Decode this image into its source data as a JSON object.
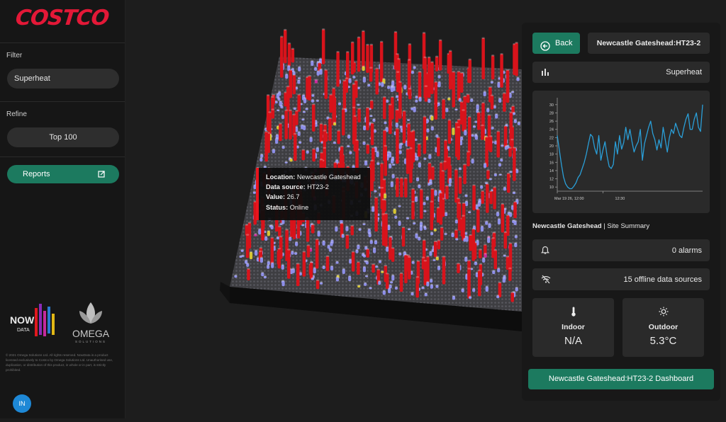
{
  "brand": {
    "logo_text": "COSTCO",
    "logo_color": "#e31837"
  },
  "sidebar": {
    "filter_label": "Filter",
    "filter_value": "Superheat",
    "refine_label": "Refine",
    "refine_value": "Top 100",
    "reports_label": "Reports",
    "reports_icon": "external-link-icon",
    "partner_logo_1": "NOW DATA",
    "partner_logo_2": "OMEGA",
    "partner_logo_2_tagline": "SOLUTIONS",
    "fine_print": "© 2021 Omega Solutions Ltd. All rights reserved. NowData is a product licensed exclusively to Costco by Omega Solutions Ltd. Unauthorised use, duplication, or distribution of this product, in whole or in part, is strictly prohibited.",
    "avatar_initials": "IN"
  },
  "tooltip": {
    "location_key": "Location:",
    "location_val": "Newcastle Gateshead",
    "source_key": "Data source:",
    "source_val": "HT23-2",
    "value_key": "Value:",
    "value_val": "26.7",
    "status_key": "Status:",
    "status_val": "Online"
  },
  "panel": {
    "back_label": "Back",
    "site_title": "Newcastle Gateshead:HT23-2",
    "metric_label": "Superheat",
    "metric_icon": "bar-chart-icon",
    "summary_site": "Newcastle Gateshead",
    "summary_suffix": " | Site Summary",
    "alarms_label": "0 alarms",
    "offline_label": "15 offline data sources",
    "indoor_label": "Indoor",
    "indoor_value": "N/A",
    "outdoor_label": "Outdoor",
    "outdoor_value": "5.3°C",
    "dashboard_label": "Newcastle Gateshead:HT23-2 Dashboard"
  },
  "colors": {
    "accent": "#1c7a5f",
    "bar_red": "#d8131b",
    "bar_blue": "#8d8ee8",
    "bar_yellow": "#d6c532",
    "bar_magenta": "#cc2a9c",
    "line": "#2a9fd8"
  },
  "chart_data": {
    "type": "line",
    "yticks": [
      10,
      12,
      14,
      16,
      18,
      20,
      22,
      24,
      26,
      28,
      30
    ],
    "ylim": [
      9,
      31
    ],
    "xtick_labels": [
      "Mar 19 26, 12:00",
      "12:30"
    ],
    "x": [
      0,
      1,
      2,
      3,
      4,
      5,
      6,
      7,
      8,
      9,
      10,
      11,
      12,
      13,
      14,
      15,
      16,
      17,
      18,
      19,
      20,
      21,
      22,
      23,
      24,
      25,
      26,
      27,
      28,
      29,
      30,
      31,
      32,
      33,
      34,
      35,
      36,
      37,
      38,
      39,
      40,
      41,
      42,
      43,
      44,
      45,
      46,
      47,
      48,
      49,
      50,
      51,
      52,
      53,
      54,
      55,
      56,
      57,
      58,
      59,
      60,
      61,
      62,
      63,
      64,
      65,
      66,
      67,
      68,
      69,
      70
    ],
    "series": [
      {
        "values": [
          22.5,
          19,
          15.5,
          12.5,
          10.8,
          10,
          9.6,
          9.6,
          10.2,
          11,
          12.3,
          13,
          14.5,
          16,
          18,
          20.5,
          22.8,
          22.2,
          19.5,
          18,
          22.5,
          16.5,
          19,
          21,
          17.5,
          15,
          14.5,
          15.5,
          21,
          18,
          22.5,
          19.2,
          20.8,
          24.5,
          21.5,
          24,
          21,
          18.5,
          20,
          21,
          24,
          16.5,
          20.5,
          22.5,
          24.5,
          26,
          23,
          21.5,
          19,
          21.5,
          19.5,
          24.5,
          21.5,
          18.5,
          22,
          24,
          23,
          25.5,
          24,
          22.5,
          22,
          24.5,
          26.5,
          27.8,
          24,
          24,
          26.5,
          28,
          24.5,
          23.5,
          30
        ]
      }
    ]
  }
}
